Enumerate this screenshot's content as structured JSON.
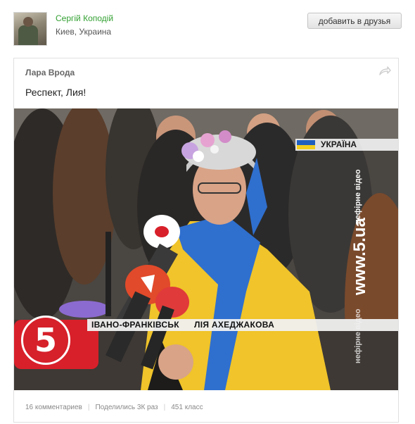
{
  "profile": {
    "name": "Сергій Коподій",
    "city": "Киев, Украина",
    "add_friend_label": "добавить в друзья"
  },
  "post": {
    "author": "Лара Врода",
    "text": "Респект, Лия!",
    "photo": {
      "channel_logo": "5",
      "top_label": "УКРАЇНА",
      "caption_city": "ІВАНО-ФРАНКІВСЬК",
      "caption_name": "ЛІЯ АХЕДЖАКОВА",
      "watermark_url": "www.5.ua",
      "watermark_show": "нефірне відео"
    },
    "footer": {
      "comments": "16 комментариев",
      "shares": "Поделились 3К раз",
      "likes": "451 класс"
    }
  },
  "colors": {
    "name_green": "#32a032",
    "ua_blue": "#1f5fc0",
    "ua_yellow": "#f2cf1f",
    "channel_red": "#d6202a"
  },
  "icons": [
    "share-icon"
  ]
}
